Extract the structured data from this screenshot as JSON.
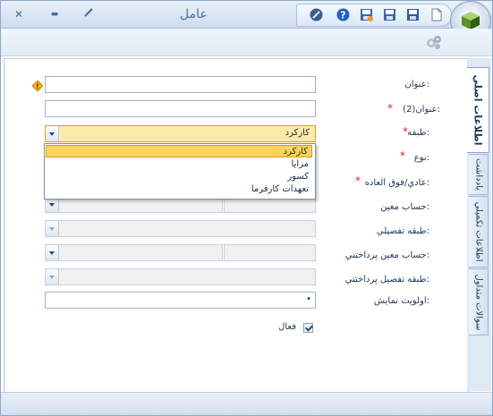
{
  "window": {
    "title": "عامل",
    "minimize_glyph": "▬",
    "close_glyph": "✕"
  },
  "toolbar": {
    "icons": [
      "orb-logo-icon",
      "tools-icon",
      "help-icon",
      "save-new-icon",
      "save-close-icon",
      "save-icon",
      "new-document-icon"
    ]
  },
  "tabs": [
    {
      "label": "اطلاعات اصلي",
      "active": true
    },
    {
      "label": "يادداشت",
      "active": false
    },
    {
      "label": "اطلاعات تكميلي",
      "active": false
    },
    {
      "label": "سوالات متداول",
      "active": false
    }
  ],
  "form": {
    "title_label": "عنوان:",
    "title2_label": "عنوان(2):",
    "category_label": "طبقه:",
    "category_value": "كاركرد",
    "type_label": "نوع:",
    "normal_extra_label": "عادي/فوق العاده:",
    "account_label": "حساب معين:",
    "detail_category_label": "طبقه تفصيلي:",
    "payable_account_label": "حساب معين پرداختني:",
    "payable_detail_category_label": "طبقه تفصيل پرداختني:",
    "display_priority_label": "اولويت نمايش:",
    "display_priority_value": "•",
    "active_label": "فعال",
    "active_checked": true,
    "required_mark": "*"
  },
  "dropdown": {
    "options": [
      "كاركرد",
      "مزايا",
      "كسور",
      "تعهدات كارفرما"
    ],
    "highlighted_index": 0
  }
}
